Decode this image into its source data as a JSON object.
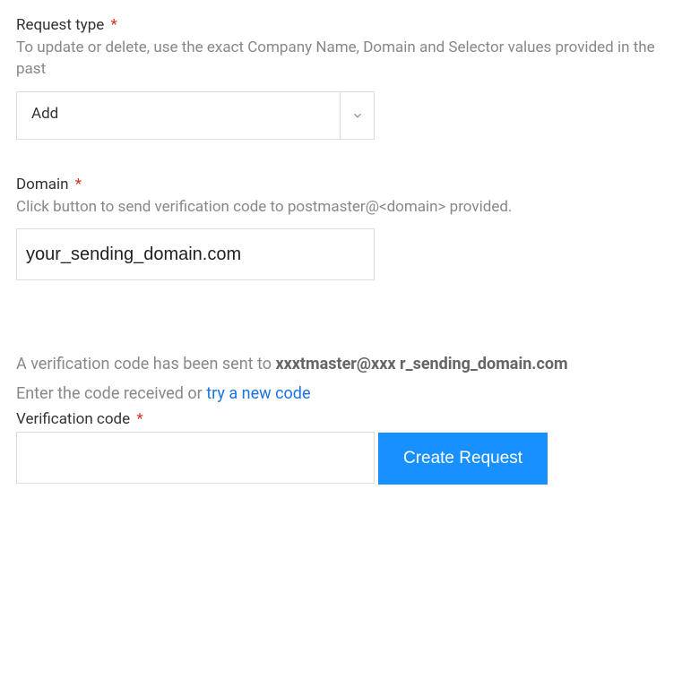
{
  "request_type": {
    "label": "Request type",
    "hint": "To update or delete, use the exact Company Name, Domain and Selector values provided in the past",
    "selected": "Add"
  },
  "domain": {
    "label": "Domain",
    "hint": "Click button to send verification code to postmaster@<domain> provided.",
    "value": "your_sending_domain.com"
  },
  "verification": {
    "sent_prefix": "A verification code has been sent to",
    "masked_email": "xxxtmaster@xxx",
    "domain_tail": " r_sending_domain.com",
    "enter_prefix": "Enter the code received or ",
    "try_new_link": "try a new code",
    "code_label": "Verification code",
    "code_value": ""
  },
  "submit": {
    "label": "Create Request"
  }
}
